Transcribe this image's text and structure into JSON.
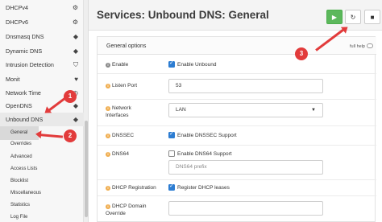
{
  "sidebar": {
    "items": [
      {
        "label": "DHCPv4",
        "icon": "gear-icon"
      },
      {
        "label": "DHCPv6",
        "icon": "gear-icon"
      },
      {
        "label": "Dnsmasq DNS",
        "icon": "tag-icon"
      },
      {
        "label": "Dynamic DNS",
        "icon": "tag-icon"
      },
      {
        "label": "Intrusion Detection",
        "icon": "shield-icon"
      },
      {
        "label": "Monit",
        "icon": "heartbeat-icon"
      },
      {
        "label": "Network Time",
        "icon": "clock-icon"
      },
      {
        "label": "OpenDNS",
        "icon": "tag-icon"
      },
      {
        "label": "Unbound DNS",
        "icon": "tag-icon"
      }
    ],
    "subitems": [
      "General",
      "Overrides",
      "Advanced",
      "Access Lists",
      "Blocklist",
      "Miscellaneous",
      "Statistics",
      "Log File"
    ]
  },
  "header": {
    "title": "Services: Unbound DNS: General",
    "buttons": {
      "play": "▶",
      "reload": "↻",
      "stop": "■"
    }
  },
  "panel": {
    "section_title": "General options",
    "full_help": "full help",
    "rows": {
      "enable": {
        "label": "Enable",
        "checkbox_label": "Enable Unbound",
        "checked": true
      },
      "listen_port": {
        "label": "Listen Port",
        "value": "53"
      },
      "network_interfaces": {
        "label_line1": "Network",
        "label_line2": "Interfaces",
        "value": "LAN"
      },
      "dnssec": {
        "label": "DNSSEC",
        "checkbox_label": "Enable DNSSEC Support",
        "checked": true
      },
      "dns64": {
        "label": "DNS64",
        "checkbox_label": "Enable DNS64 Support",
        "checked": false,
        "placeholder": "DNS64 prefix"
      },
      "dhcp_registration": {
        "label": "DHCP Registration",
        "checkbox_label": "Register DHCP leases",
        "checked": true
      },
      "dhcp_domain_override": {
        "label_line1": "DHCP Domain",
        "label_line2": "Override"
      }
    }
  },
  "annotations": {
    "badges": [
      "1",
      "2",
      "3"
    ],
    "color": "#e23b3b"
  },
  "colors": {
    "accent": "#2d7dd2",
    "success": "#5cb85c",
    "info": "#f0ad4e"
  }
}
